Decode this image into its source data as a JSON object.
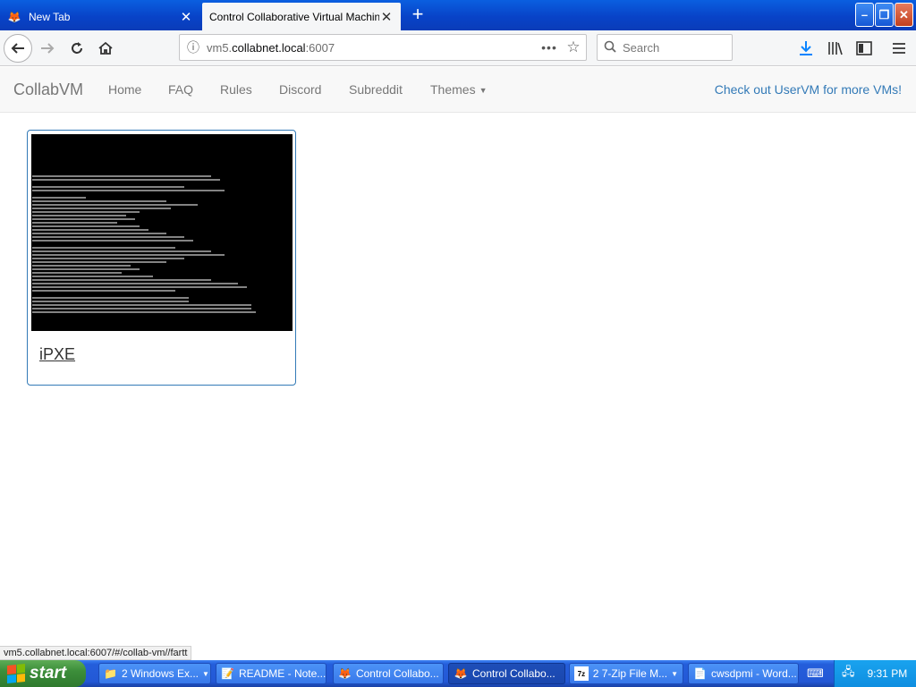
{
  "browser": {
    "tabs": [
      {
        "label": "New Tab",
        "icon": "firefox-icon",
        "close": "✕"
      },
      {
        "label": "Control Collaborative Virtual Machines!",
        "icon": "collabvm-favicon",
        "close": "✕"
      }
    ],
    "new_tab": "+",
    "window_buttons": {
      "minimize": "–",
      "maximize": "❐",
      "close": "✕"
    },
    "url_prefix": "vm5.",
    "url_domain": "collabnet.local",
    "url_suffix": ":6007",
    "page_actions": "•••",
    "search_placeholder": "Search",
    "status_url": "vm5.collabnet.local:6007/#/collab-vm//fartt"
  },
  "site": {
    "brand": "CollabVM",
    "nav": [
      "Home",
      "FAQ",
      "Rules",
      "Discord",
      "Subreddit",
      "Themes"
    ],
    "promo": "Check out UserVM for more VMs!",
    "link_color": "#337ab7"
  },
  "vm": {
    "title": "iPXE"
  },
  "taskbar": {
    "start": "start",
    "tasks": [
      {
        "label": "2 Windows Ex...",
        "icon": "folder-icon"
      },
      {
        "label": "README - Note...",
        "icon": "notepad-icon"
      },
      {
        "label": "Control Collabo...",
        "icon": "firefox-icon"
      },
      {
        "label": "Control Collabo...",
        "icon": "firefox-icon"
      },
      {
        "label": "2 7-Zip File M...",
        "icon": "7zip-icon"
      },
      {
        "label": "cwsdpmi - Word...",
        "icon": "wordpad-icon"
      }
    ],
    "clock": "9:31 PM"
  }
}
